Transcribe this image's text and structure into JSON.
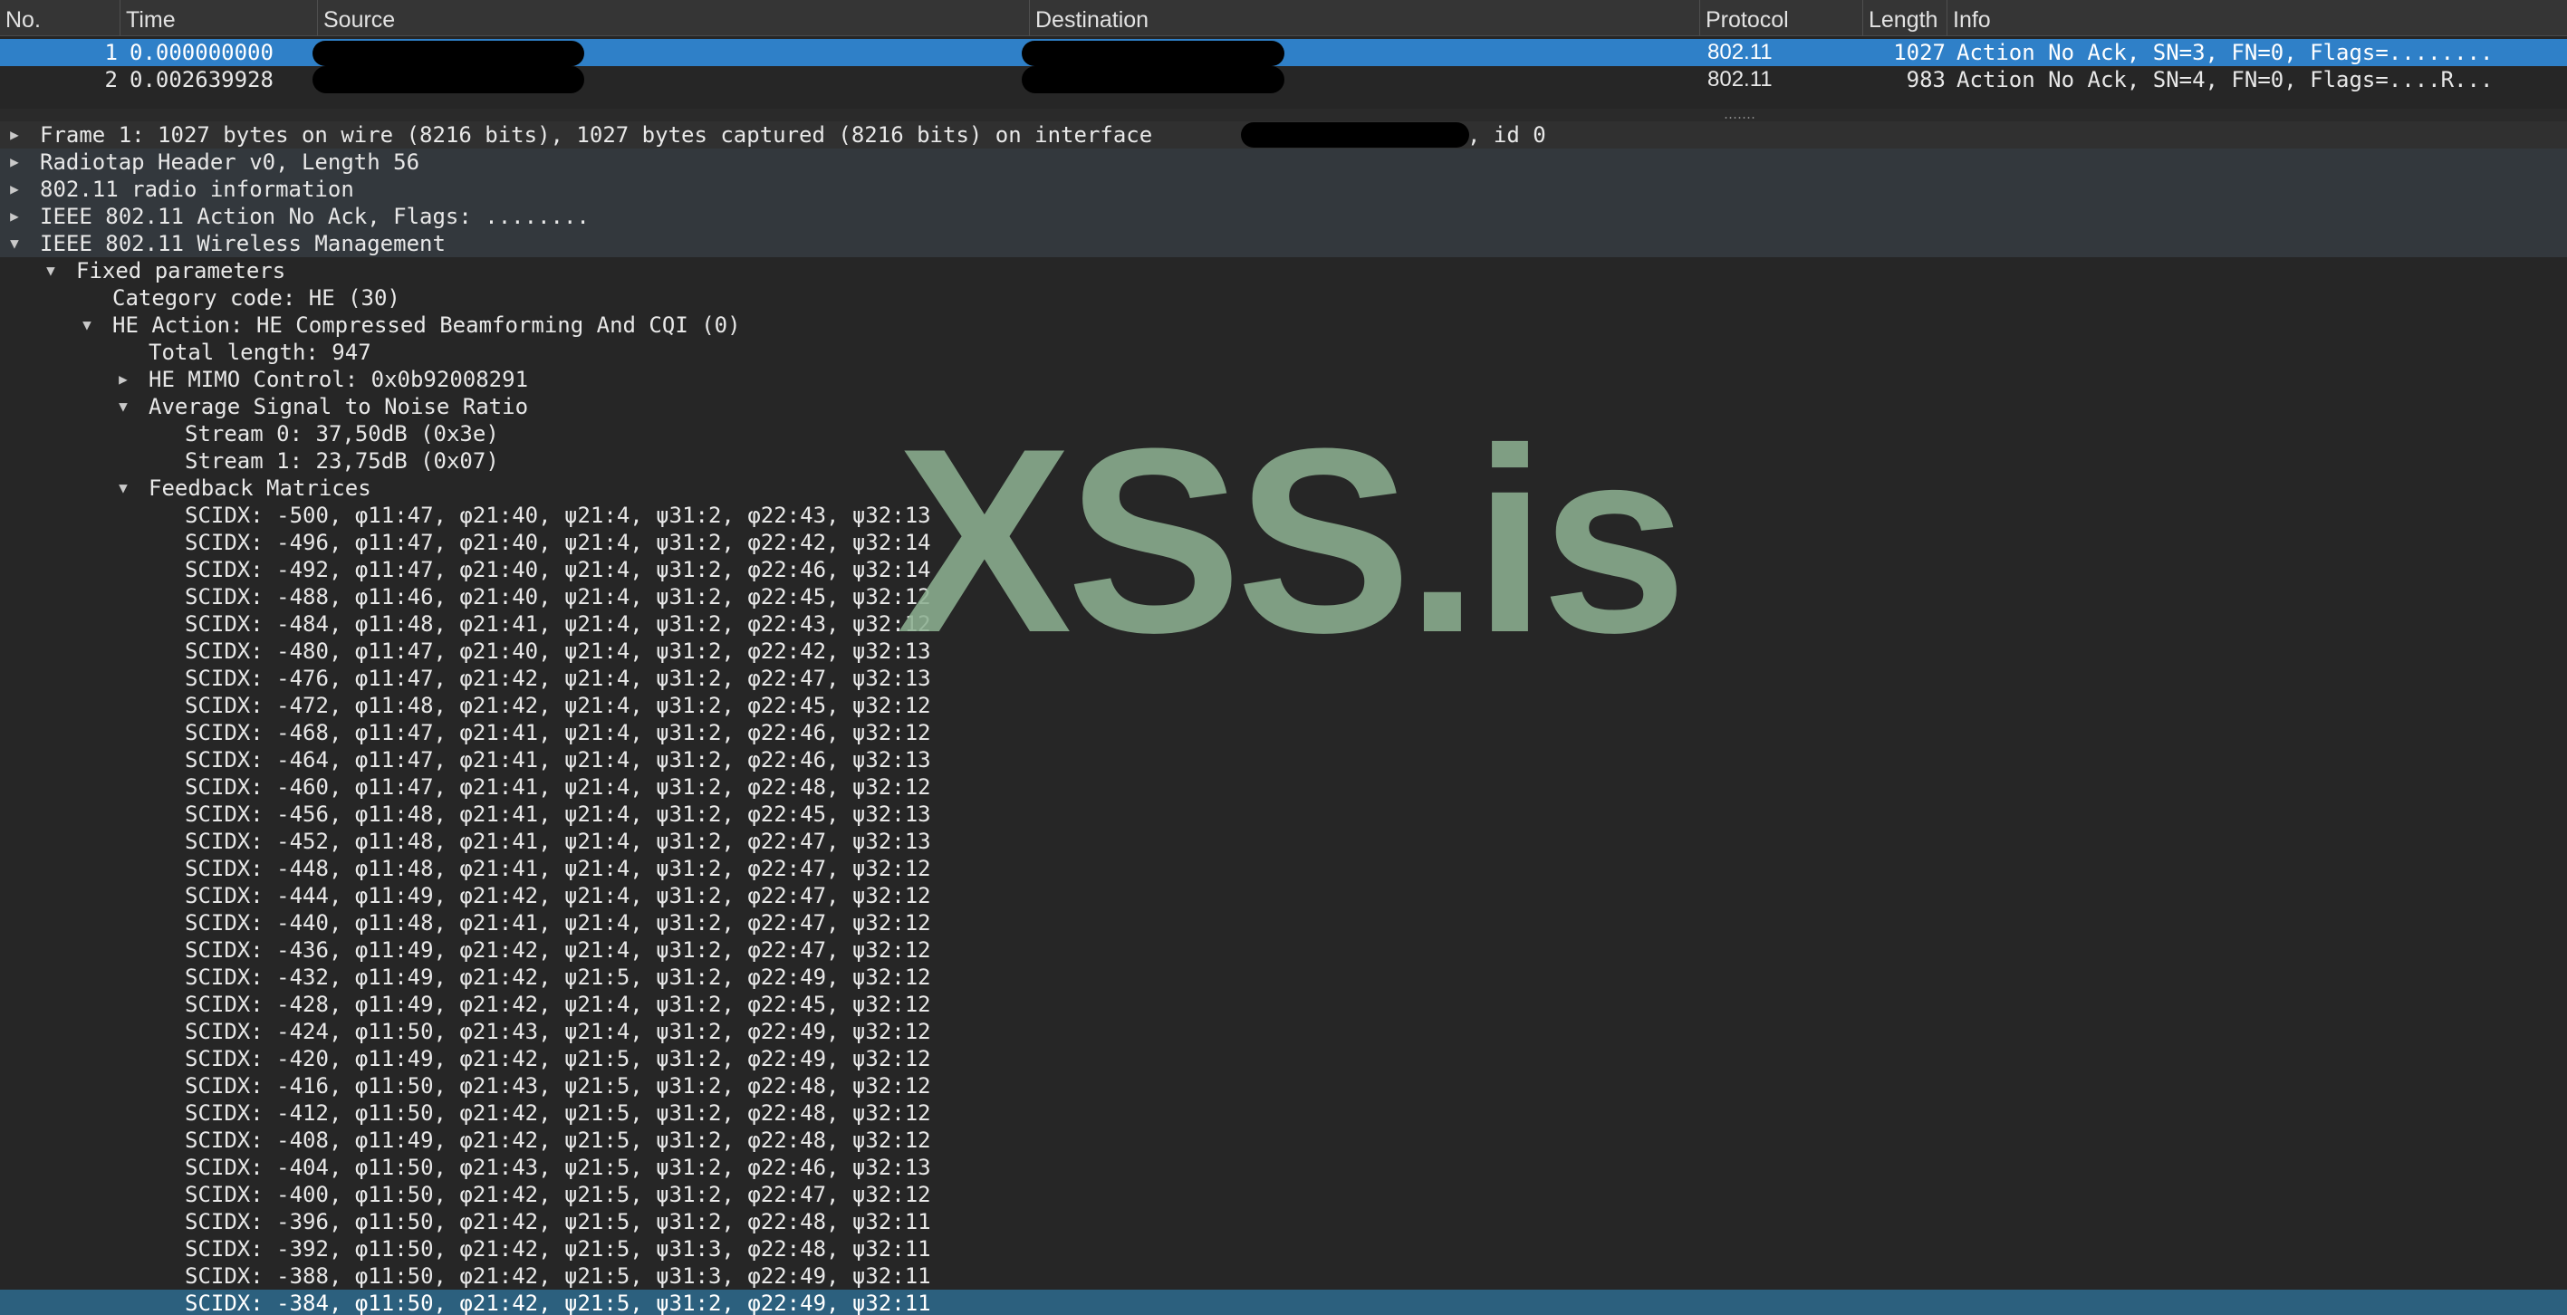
{
  "packet_list": {
    "columns": [
      "No.",
      "Time",
      "Source",
      "Destination",
      "Protocol",
      "Length",
      "Info"
    ],
    "rows": [
      {
        "no": "1",
        "time": "0.000000000",
        "protocol": "802.11",
        "length": "1027",
        "info": "Action No Ack, SN=3, FN=0, Flags=........"
      },
      {
        "no": "2",
        "time": "0.002639928",
        "protocol": "802.11",
        "length": "983",
        "info": "Action No Ack, SN=4, FN=0, Flags=....R..."
      }
    ]
  },
  "details": {
    "frame": {
      "prefix": "Frame 1: 1027 bytes on wire (8216 bits), 1027 bytes captured (8216 bits) on interface",
      "suffix": ", id 0"
    },
    "radiotap": "Radiotap Header v0, Length 56",
    "radio_info": "802.11 radio information",
    "action_no_ack": "IEEE 802.11 Action No Ack, Flags: ........",
    "wireless_mgmt": "IEEE 802.11 Wireless Management",
    "fixed_params": "Fixed parameters",
    "category_code": "Category code: HE (30)",
    "he_action": "HE Action: HE Compressed Beamforming And CQI (0)",
    "total_length": "Total length: 947",
    "mimo_control": "HE MIMO Control: 0x0b92008291",
    "avg_snr": "Average Signal to Noise Ratio",
    "stream0": "Stream 0: 37,50dB (0x3e)",
    "stream1": "Stream 1: 23,75dB (0x07)",
    "feedback_matrices": "Feedback Matrices",
    "scidx_rows": [
      "SCIDX: -500, φ11:47, φ21:40, ψ21:4, ψ31:2, φ22:43, ψ32:13",
      "SCIDX: -496, φ11:47, φ21:40, ψ21:4, ψ31:2, φ22:42, ψ32:14",
      "SCIDX: -492, φ11:47, φ21:40, ψ21:4, ψ31:2, φ22:46, ψ32:14",
      "SCIDX: -488, φ11:46, φ21:40, ψ21:4, ψ31:2, φ22:45, ψ32:12",
      "SCIDX: -484, φ11:48, φ21:41, ψ21:4, ψ31:2, φ22:43, ψ32:12",
      "SCIDX: -480, φ11:47, φ21:40, ψ21:4, ψ31:2, φ22:42, ψ32:13",
      "SCIDX: -476, φ11:47, φ21:42, ψ21:4, ψ31:2, φ22:47, ψ32:13",
      "SCIDX: -472, φ11:48, φ21:42, ψ21:4, ψ31:2, φ22:45, ψ32:12",
      "SCIDX: -468, φ11:47, φ21:41, ψ21:4, ψ31:2, φ22:46, ψ32:12",
      "SCIDX: -464, φ11:47, φ21:41, ψ21:4, ψ31:2, φ22:46, ψ32:13",
      "SCIDX: -460, φ11:47, φ21:41, ψ21:4, ψ31:2, φ22:48, ψ32:12",
      "SCIDX: -456, φ11:48, φ21:41, ψ21:4, ψ31:2, φ22:45, ψ32:13",
      "SCIDX: -452, φ11:48, φ21:41, ψ21:4, ψ31:2, φ22:47, ψ32:13",
      "SCIDX: -448, φ11:48, φ21:41, ψ21:4, ψ31:2, φ22:47, ψ32:12",
      "SCIDX: -444, φ11:49, φ21:42, ψ21:4, ψ31:2, φ22:47, ψ32:12",
      "SCIDX: -440, φ11:48, φ21:41, ψ21:4, ψ31:2, φ22:47, ψ32:12",
      "SCIDX: -436, φ11:49, φ21:42, ψ21:4, ψ31:2, φ22:47, ψ32:12",
      "SCIDX: -432, φ11:49, φ21:42, ψ21:5, ψ31:2, φ22:49, ψ32:12",
      "SCIDX: -428, φ11:49, φ21:42, ψ21:4, ψ31:2, φ22:45, ψ32:12",
      "SCIDX: -424, φ11:50, φ21:43, ψ21:4, ψ31:2, φ22:49, ψ32:12",
      "SCIDX: -420, φ11:49, φ21:42, ψ21:5, ψ31:2, φ22:49, ψ32:12",
      "SCIDX: -416, φ11:50, φ21:43, ψ21:5, ψ31:2, φ22:48, ψ32:12",
      "SCIDX: -412, φ11:50, φ21:42, ψ21:5, ψ31:2, φ22:48, ψ32:12",
      "SCIDX: -408, φ11:49, φ21:42, ψ21:5, ψ31:2, φ22:48, ψ32:12",
      "SCIDX: -404, φ11:50, φ21:43, ψ21:5, ψ31:2, φ22:46, ψ32:13",
      "SCIDX: -400, φ11:50, φ21:42, ψ21:5, ψ31:2, φ22:47, ψ32:12",
      "SCIDX: -396, φ11:50, φ21:42, ψ21:5, ψ31:2, φ22:48, ψ32:11",
      "SCIDX: -392, φ11:50, φ21:42, ψ21:5, ψ31:3, φ22:48, ψ32:11",
      "SCIDX: -388, φ11:50, φ21:42, ψ21:5, ψ31:3, φ22:49, ψ32:11",
      "SCIDX: -384, φ11:50, φ21:42, ψ21:5, ψ31:2, φ22:49, ψ32:11"
    ]
  },
  "watermark": "XSS.is",
  "colors": {
    "selected_row": "#2f80c8",
    "selected_tree_row": "#2c607e",
    "background": "#252525",
    "watermark": "#8caf91"
  },
  "icons": {
    "collapsed": "triangle-right-icon",
    "expanded": "triangle-down-icon"
  }
}
